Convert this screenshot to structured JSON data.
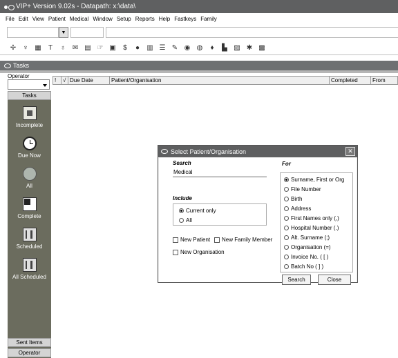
{
  "window": {
    "title": "VIP+  Version 9.02s - Datapath: x:\\data\\"
  },
  "menu": [
    "File",
    "Edit",
    "View",
    "Patient",
    "Medical",
    "Window",
    "Setup",
    "Reports",
    "Help",
    "Fastkeys",
    "Family"
  ],
  "toolbar_icons": [
    "pill-icon",
    "stethoscope-icon",
    "grid-icon",
    "text-icon",
    "flask-icon",
    "mail-icon",
    "chart-icon",
    "pointer-icon",
    "document-icon",
    "dollar-icon",
    "coin-icon",
    "folder-icon",
    "list-icon",
    "syringe-icon",
    "globe-icon",
    "disc-icon",
    "drop-icon",
    "bar-chart-icon",
    "picture-icon",
    "tools-icon",
    "print-icon"
  ],
  "tasks_panel": {
    "title": "Tasks",
    "operator_label": "Operator",
    "tasks_button": "Tasks",
    "items": [
      {
        "label": "Incomplete",
        "icon": "clipboard-icon"
      },
      {
        "label": "Due Now",
        "icon": "clock-icon"
      },
      {
        "label": "All",
        "icon": "globe-icon"
      },
      {
        "label": "Complete",
        "icon": "checklist-icon"
      },
      {
        "label": "Scheduled",
        "icon": "calendar-icon"
      },
      {
        "label": "All Scheduled",
        "icon": "calendar-stack-icon"
      }
    ],
    "sent_items_button": "Sent Items",
    "operator_button": "Operator"
  },
  "grid": {
    "columns": [
      "!",
      "√",
      "Due Date",
      "Patient/Organisation",
      "Completed",
      "From"
    ]
  },
  "dialog": {
    "title": "Select Patient/Organisation",
    "close_glyph": "✕",
    "search_label": "Search",
    "search_value": "Medical",
    "include_label": "Include",
    "include_options": [
      {
        "label": "Current only",
        "selected": true
      },
      {
        "label": "All",
        "selected": false
      }
    ],
    "new_patient": "New Patient",
    "new_family_member": "New Family Member",
    "new_organisation": "New Organisation",
    "for_label": "For",
    "for_options": [
      {
        "label": "Surname, First or Org",
        "selected": true
      },
      {
        "label": "File Number",
        "selected": false
      },
      {
        "label": "Birth",
        "selected": false
      },
      {
        "label": "Address",
        "selected": false
      },
      {
        "label": "First Names only (,)",
        "selected": false
      },
      {
        "label": "Hospital Number (.)",
        "selected": false
      },
      {
        "label": "Alt. Surname (;)",
        "selected": false
      },
      {
        "label": "Organisation (=)",
        "selected": false
      },
      {
        "label": "Invoice No. ( [ )",
        "selected": false
      },
      {
        "label": "Batch No ( ] )",
        "selected": false
      }
    ],
    "search_button": "Search",
    "close_button": "Close"
  }
}
